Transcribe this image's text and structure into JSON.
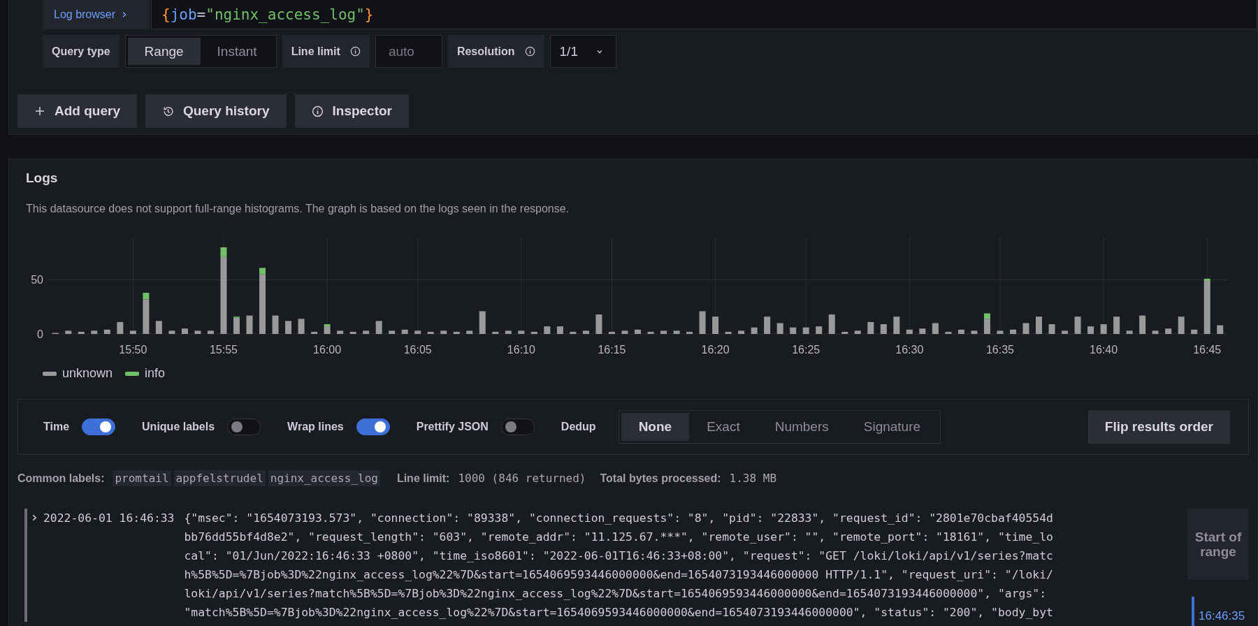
{
  "query_editor": {
    "log_browser_button": "Log browser",
    "query": [
      {
        "kind": "brace",
        "text": "{"
      },
      {
        "kind": "key",
        "text": "job"
      },
      {
        "kind": "op",
        "text": "="
      },
      {
        "kind": "string",
        "text": "\"nginx_access_log\""
      },
      {
        "kind": "brace",
        "text": "}"
      }
    ],
    "query_type": {
      "label": "Query type",
      "options": [
        {
          "label": "Range",
          "selected": true
        },
        {
          "label": "Instant",
          "selected": false
        }
      ]
    },
    "line_limit": {
      "label": "Line limit",
      "placeholder": "auto"
    },
    "resolution": {
      "label": "Resolution",
      "value": "1/1"
    },
    "buttons": [
      {
        "kind": "add",
        "label": "Add query"
      },
      {
        "kind": "history",
        "label": "Query history"
      },
      {
        "kind": "info",
        "label": "Inspector"
      }
    ]
  },
  "logs": {
    "title": "Logs",
    "notice": "This datasource does not support full-range histograms. The graph is based on the logs seen in the response.",
    "chart_data": {
      "type": "bar",
      "stacked": true,
      "grid": true,
      "legend": "bottom-left",
      "ylim": [
        0,
        89
      ],
      "yticks": [
        0,
        50
      ],
      "categories": [
        null,
        null,
        null,
        null,
        null,
        null,
        "15:50",
        null,
        null,
        null,
        null,
        null,
        null,
        "15:55",
        null,
        null,
        null,
        null,
        null,
        null,
        null,
        "16:00",
        null,
        null,
        null,
        null,
        null,
        null,
        "16:05",
        null,
        null,
        null,
        null,
        null,
        null,
        null,
        "16:10",
        null,
        null,
        null,
        null,
        null,
        null,
        "16:15",
        null,
        null,
        null,
        null,
        null,
        null,
        null,
        "16:20",
        null,
        null,
        null,
        null,
        null,
        null,
        "16:25",
        null,
        null,
        null,
        null,
        null,
        null,
        null,
        "16:30",
        null,
        null,
        null,
        null,
        null,
        null,
        "16:35",
        null,
        null,
        null,
        null,
        null,
        null,
        null,
        "16:40",
        null,
        null,
        null,
        null,
        null,
        null,
        null,
        "16:45",
        null
      ],
      "series": [
        {
          "name": "unknown",
          "color": "#999999",
          "values": [
            1,
            3,
            2,
            3,
            4,
            11,
            3,
            32,
            12,
            3,
            5,
            3,
            3,
            71,
            15,
            17,
            55,
            17,
            12,
            14,
            2,
            7,
            3,
            2,
            3,
            12,
            3,
            4,
            3,
            2,
            3,
            2,
            3,
            21,
            2,
            3,
            3,
            2,
            7,
            7,
            2,
            3,
            18,
            2,
            3,
            4,
            2,
            3,
            3,
            2,
            21,
            16,
            2,
            3,
            6,
            16,
            10,
            6,
            6,
            7,
            18,
            2,
            3,
            11,
            9,
            16,
            4,
            5,
            10,
            2,
            4,
            3,
            14,
            3,
            4,
            10,
            16,
            9,
            3,
            16,
            7,
            9,
            16,
            3,
            17,
            3,
            5,
            16,
            4,
            49,
            8
          ]
        },
        {
          "name": "info",
          "color": "#73bf69",
          "values": [
            0,
            0,
            0,
            0,
            0,
            0,
            0,
            6,
            0,
            0,
            0,
            0,
            0,
            9,
            1,
            0,
            6,
            0,
            0,
            0,
            0,
            2,
            0,
            0,
            0,
            0,
            0,
            0,
            0,
            0,
            0,
            0,
            0,
            0,
            0,
            0,
            0,
            0,
            0,
            0,
            0,
            0,
            0,
            0,
            0,
            0,
            0,
            0,
            0,
            0,
            0,
            0,
            0,
            0,
            0,
            0,
            0,
            0,
            0,
            0,
            0,
            0,
            0,
            0,
            0,
            0,
            0,
            0,
            0,
            0,
            0,
            0,
            5,
            0,
            0,
            0,
            0,
            0,
            0,
            0,
            0,
            0,
            0,
            0,
            0,
            0,
            0,
            0,
            0,
            2,
            0
          ]
        }
      ]
    },
    "options": {
      "toggles": [
        {
          "label": "Time",
          "on": true
        },
        {
          "label": "Unique labels",
          "on": false
        },
        {
          "label": "Wrap lines",
          "on": true
        },
        {
          "label": "Prettify JSON",
          "on": false
        }
      ],
      "dedup": {
        "label": "Dedup",
        "options": [
          {
            "label": "None",
            "selected": true
          },
          {
            "label": "Exact",
            "selected": false
          },
          {
            "label": "Numbers",
            "selected": false
          },
          {
            "label": "Signature",
            "selected": false
          }
        ]
      },
      "flip_button": "Flip results order"
    },
    "meta": {
      "common_labels": {
        "label": "Common labels:",
        "values": [
          "promtail",
          "appfelstrudel",
          "nginx_access_log"
        ]
      },
      "line_limit": {
        "label": "Line limit:",
        "value": "1000 (846 returned)"
      },
      "bytes": {
        "label": "Total bytes processed:",
        "value": "1.38 MB"
      }
    },
    "rows": [
      {
        "timestamp": "2022-06-01 16:46:33",
        "message_lines": [
          "{\"msec\": \"1654073193.573\", \"connection\": \"89338\", \"connection_requests\": \"8\", \"pid\": \"22833\", \"request_id\": \"2801e70cbaf40554d",
          "bb76dd55bf4d8e2\", \"request_length\": \"603\", \"remote_addr\": \"11.125.67.***\", \"remote_user\": \"\", \"remote_port\": \"18161\", \"time_lo",
          "cal\": \"01/Jun/2022:16:46:33 +0800\", \"time_iso8601\": \"2022-06-01T16:46:33+08:00\", \"request\": \"GET /loki/loki/api/v1/series?matc",
          "h%5B%5D=%7Bjob%3D%22nginx_access_log%22%7D&start=1654069593446000000&end=1654073193446000000 HTTP/1.1\", \"request_uri\": \"/loki/",
          "loki/api/v1/series?match%5B%5D=%7Bjob%3D%22nginx_access_log%22%7D&start=1654069593446000000&end=1654073193446000000\", \"args\":",
          "\"match%5B%5D=%7Bjob%3D%22nginx_access_log%22%7D&start=1654069593446000000&end=1654073193446000000\", \"status\": \"200\", \"body_byt"
        ]
      }
    ],
    "navigation": {
      "start_button": "Start of range",
      "time": "16:46:35"
    }
  }
}
